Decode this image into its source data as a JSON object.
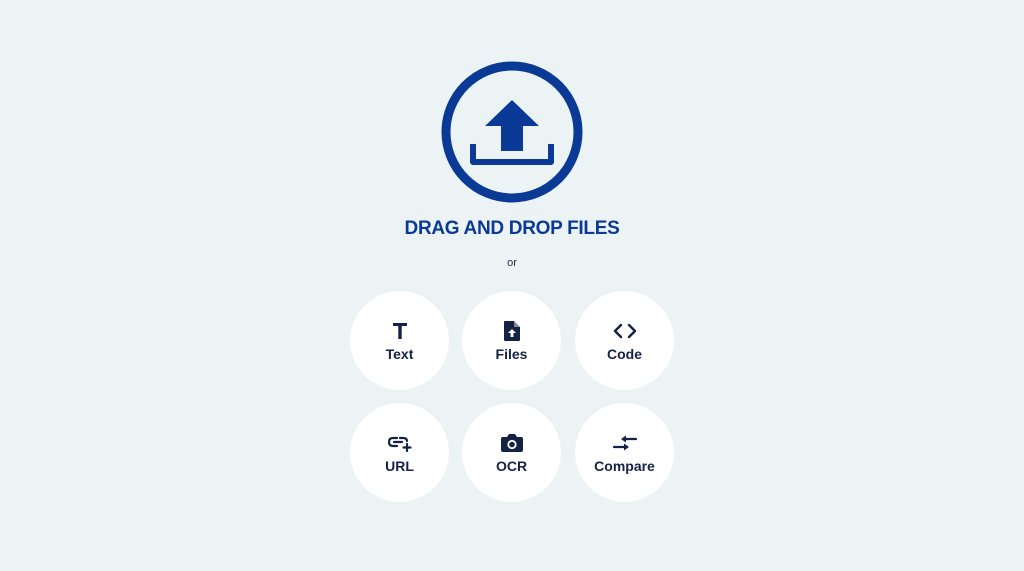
{
  "colors": {
    "background": "#EBF3F5",
    "accent": "#0B3A96",
    "button_bg": "#FFFFFF",
    "button_text": "#142244"
  },
  "dropzone": {
    "icon": "upload-icon",
    "title": "DRAG AND DROP FILES",
    "separator": "or"
  },
  "options": [
    {
      "label": "Text",
      "icon": "text-icon"
    },
    {
      "label": "Files",
      "icon": "file-upload-icon"
    },
    {
      "label": "Code",
      "icon": "code-icon"
    },
    {
      "label": "URL",
      "icon": "link-add-icon"
    },
    {
      "label": "OCR",
      "icon": "camera-icon"
    },
    {
      "label": "Compare",
      "icon": "compare-arrows-icon"
    }
  ]
}
